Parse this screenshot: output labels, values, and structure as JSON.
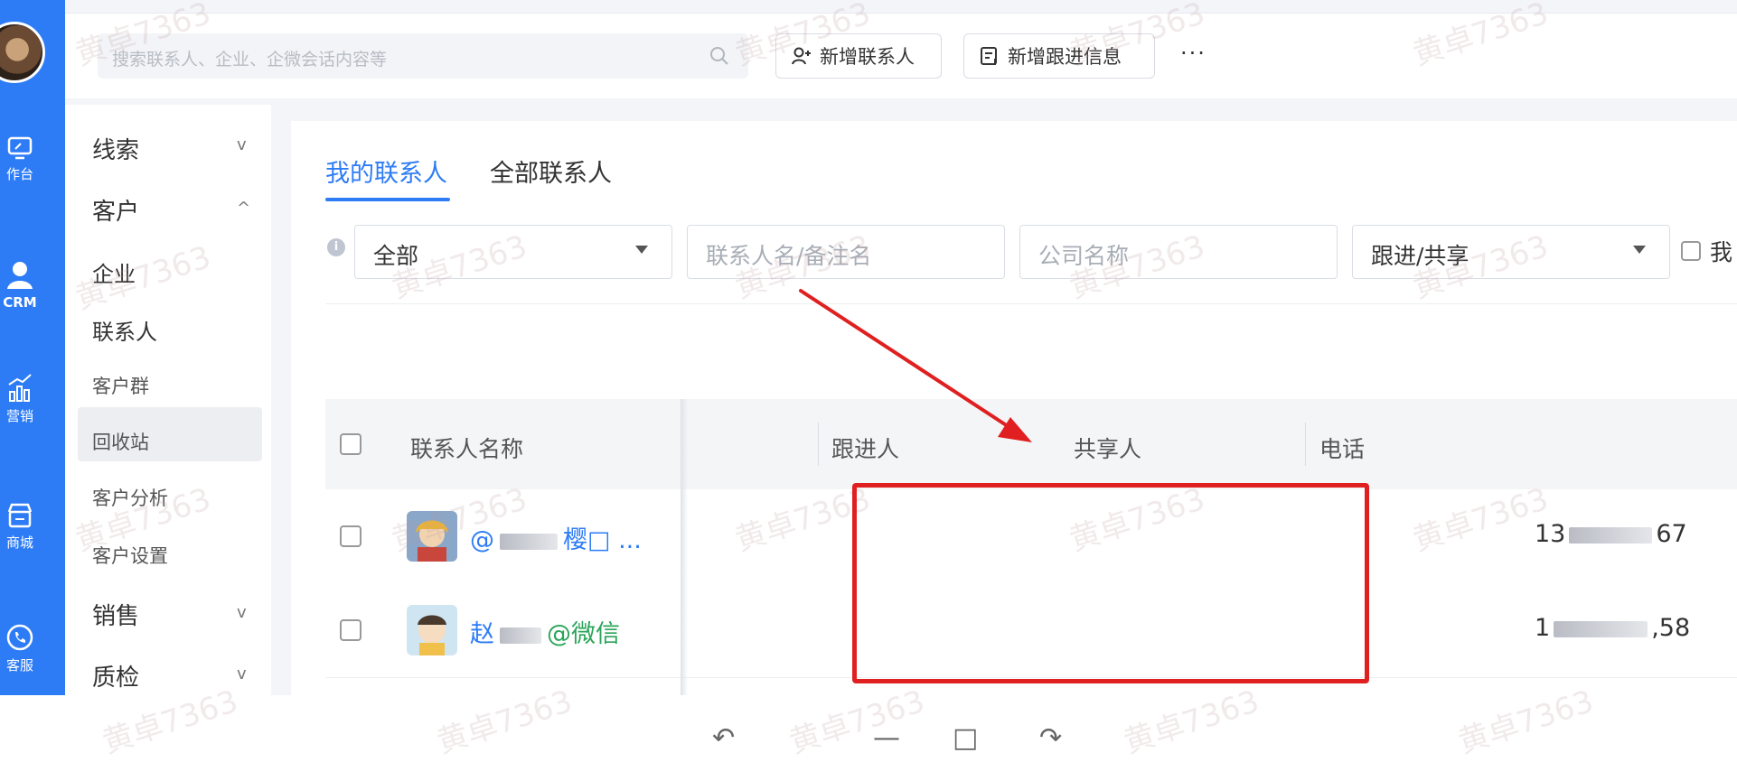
{
  "header": {
    "search_placeholder": "搜索联系人、企业、企微会话内容等",
    "new_contact_label": "新增联系人",
    "new_followup_label": "新增跟进信息",
    "more_label": "···"
  },
  "rail": {
    "items": [
      {
        "label": "作台",
        "icon": "monitor-icon"
      },
      {
        "label": "CRM",
        "icon": "user-icon"
      },
      {
        "label": "营销",
        "icon": "chart-icon"
      },
      {
        "label": "商城",
        "icon": "shop-icon"
      },
      {
        "label": "客服",
        "icon": "phone-icon"
      }
    ]
  },
  "subnav": {
    "groups": [
      {
        "label": "线索",
        "chevron": "v"
      },
      {
        "label": "客户",
        "chevron": "^"
      },
      {
        "label": "销售",
        "chevron": "v"
      },
      {
        "label": "质检",
        "chevron": "v"
      }
    ],
    "customer_children": [
      "企业",
      "联系人",
      "客户群",
      "回收站",
      "客户分析",
      "客户设置"
    ],
    "active_item": "联系人"
  },
  "tabs": [
    "我的联系人",
    "全部联系人"
  ],
  "filters": {
    "scope_value": "全部",
    "name_placeholder": "联系人名/备注名",
    "company_placeholder": "公司名称",
    "follow_share_value": "跟进/共享",
    "checkbox_label_partial": "我"
  },
  "table": {
    "columns": [
      "联系人名称",
      "跟进人",
      "共享人",
      "电话"
    ],
    "rows": [
      {
        "name_prefix": "@",
        "name_tail": "樱□ ...",
        "phone_prefix": "13",
        "phone_suffix": "67"
      },
      {
        "name_prefix": "赵",
        "name_tail": "@微信",
        "phone_prefix": "1",
        "phone_suffix": ",58"
      }
    ]
  },
  "watermark": "黄卓7363",
  "bottom_toolbar": [
    "↶",
    "↷",
    "—",
    "□"
  ],
  "colors": {
    "primary": "#2d7cf6",
    "annotation": "#e02020",
    "wechat_green": "#2aa55a"
  }
}
